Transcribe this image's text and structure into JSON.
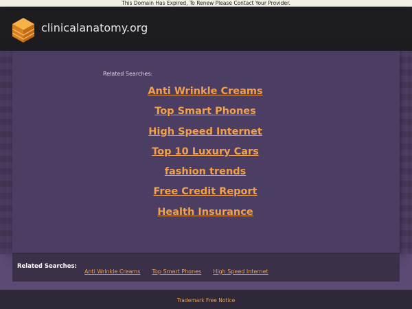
{
  "notice": "This Domain Has Expired, To Renew Please Contact Your Provider.",
  "site": {
    "name": "clinicalanatomy.org",
    "logo_icon": "stacked-layers-icon"
  },
  "main": {
    "related_label": "Related Searches:",
    "links": [
      "Anti Wrinkle Creams",
      "Top Smart Phones",
      "High Speed Internet",
      "Top 10 Luxury Cars",
      "fashion trends",
      "Free Credit Report",
      "Health Insurance"
    ]
  },
  "footer": {
    "related_label": "Related Searches:",
    "links": [
      "Anti Wrinkle Creams",
      "Top Smart Phones",
      "High Speed Internet"
    ],
    "trademark": "Trademark Free Notice"
  },
  "colors": {
    "accent": "#f2a14a",
    "header_bg": "#1d1d1f",
    "page_bg": "#5b4a73",
    "logo_orange": "#f7a233"
  }
}
